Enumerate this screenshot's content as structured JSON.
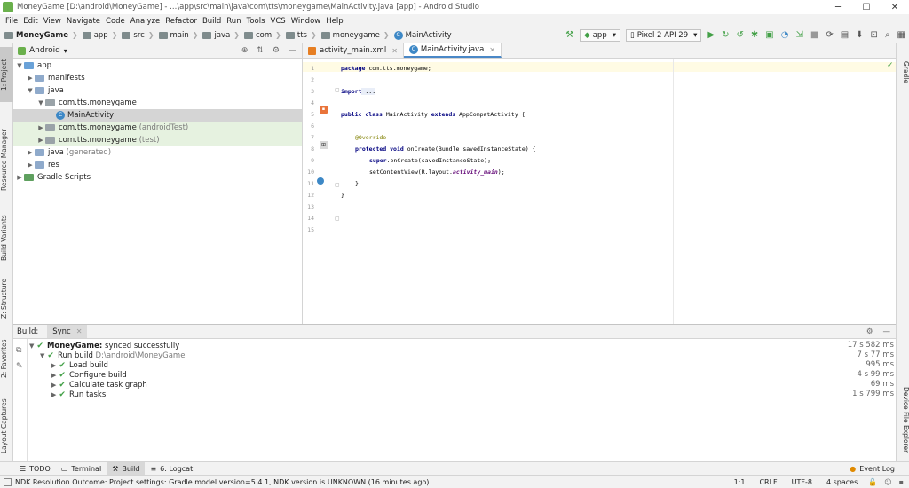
{
  "window": {
    "title": "MoneyGame [D:\\android\\MoneyGame] - ...\\app\\src\\main\\java\\com\\tts\\moneygame\\MainActivity.java [app] - Android Studio",
    "minimize": "─",
    "maximize": "☐",
    "close": "✕"
  },
  "menu": [
    "File",
    "Edit",
    "View",
    "Navigate",
    "Code",
    "Analyze",
    "Refactor",
    "Build",
    "Run",
    "Tools",
    "VCS",
    "Window",
    "Help"
  ],
  "breadcrumbs": [
    "MoneyGame",
    "app",
    "src",
    "main",
    "java",
    "com",
    "tts",
    "moneygame",
    "MainActivity"
  ],
  "toolbar": {
    "config": "app",
    "device": "Pixel 2 API 29"
  },
  "left_strip": {
    "project": "1: Project",
    "resource_manager": "Resource Manager",
    "build_variants": "Build Variants",
    "structure": "Z: Structure",
    "favorites": "2: Favorites",
    "layout_captures": "Layout Captures"
  },
  "right_strip": {
    "gradle": "Gradle",
    "device_file_explorer": "Device File Explorer"
  },
  "project": {
    "view": "Android",
    "tree": {
      "app": "app",
      "manifests": "manifests",
      "java": "java",
      "pkg_main": "com.tts.moneygame",
      "main_activity": "MainActivity",
      "pkg_android_test": "com.tts.moneygame",
      "pkg_android_test_suffix": "(androidTest)",
      "pkg_test": "com.tts.moneygame",
      "pkg_test_suffix": "(test)",
      "java_generated": "java",
      "java_generated_suffix": "(generated)",
      "res": "res",
      "gradle_scripts": "Gradle Scripts"
    }
  },
  "editor": {
    "tabs": [
      {
        "label": "activity_main.xml"
      },
      {
        "label": "MainActivity.java"
      }
    ],
    "line_numbers": [
      "1",
      "2",
      "3",
      "4",
      "5",
      "6",
      "7",
      "8",
      "9",
      "10",
      "11",
      "12",
      "13",
      "14",
      "15"
    ],
    "code": {
      "l1_kw": "package",
      "l1_rest": " com.tts.moneygame;",
      "l3_kw": "import",
      "l3_rest": " ...",
      "l6_kw": "public class",
      "l6_mid": " MainActivity ",
      "l6_kw2": "extends",
      "l6_rest": " AppCompatActivity {",
      "l9_ann": "@Override",
      "l10_kw": "protected void",
      "l10_rest": " onCreate(Bundle savedInstanceState) {",
      "l11_kw": "super",
      "l11_rest": ".onCreate(savedInstanceState);",
      "l12_pre": "setContentView(R.layout.",
      "l12_fld": "activity_main",
      "l12_post": ");",
      "l13": "}",
      "l15": "}"
    }
  },
  "build": {
    "label": "Build:",
    "tab": "Sync",
    "rows": [
      {
        "title": "MoneyGame:",
        "detail": "synced successfully",
        "time": "17 s 582 ms"
      },
      {
        "title": "Run build",
        "detail": "D:\\android\\MoneyGame",
        "time": "7 s 77 ms"
      },
      {
        "title": "Load build",
        "detail": "",
        "time": "995 ms"
      },
      {
        "title": "Configure build",
        "detail": "",
        "time": "4 s 99 ms"
      },
      {
        "title": "Calculate task graph",
        "detail": "",
        "time": "69 ms"
      },
      {
        "title": "Run tasks",
        "detail": "",
        "time": "1 s 799 ms"
      }
    ]
  },
  "bottom_tools": {
    "todo": "TODO",
    "terminal": "Terminal",
    "build": "Build",
    "logcat": "6: Logcat",
    "event_log": "Event Log"
  },
  "status": {
    "message": "NDK Resolution Outcome: Project settings: Gradle model version=5.4.1, NDK version is UNKNOWN (16 minutes ago)",
    "position": "1:1",
    "line_sep": "CRLF",
    "encoding": "UTF-8",
    "indent": "4 spaces"
  },
  "colors": {
    "accent": "#4a88c7",
    "success": "#43a047",
    "selection": "#d5d5d5",
    "test_bg": "#e6f2e0"
  }
}
